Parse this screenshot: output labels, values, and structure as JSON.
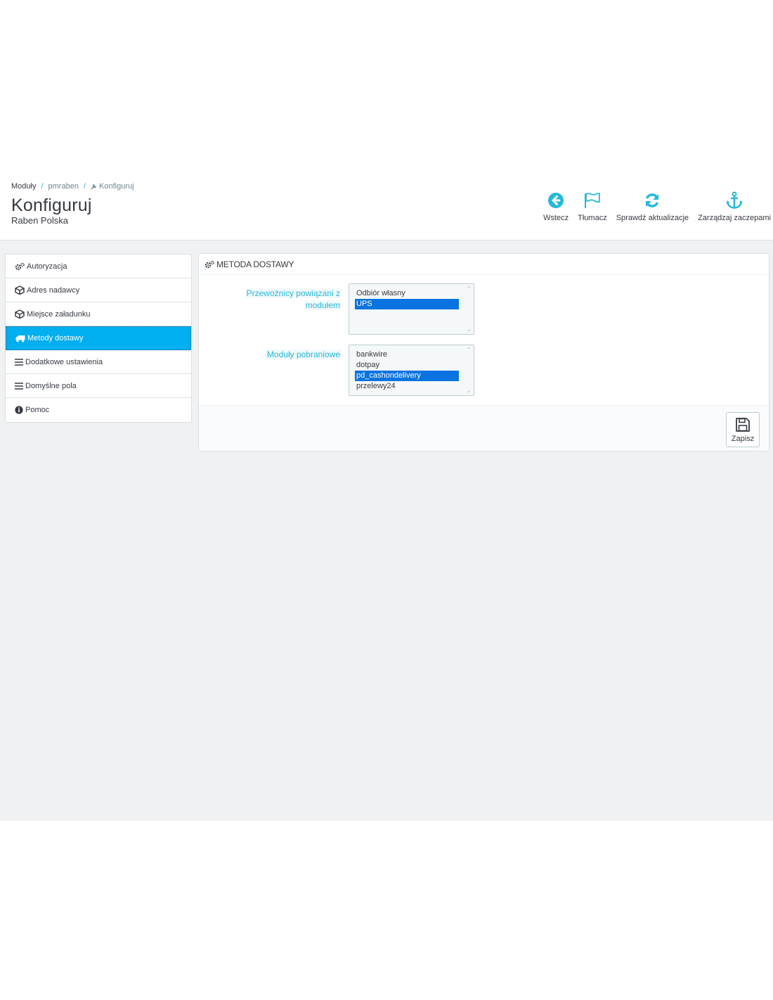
{
  "breadcrumb": {
    "root": "Moduły",
    "parent": "pmraben",
    "current": "Konfiguruj",
    "separator": "/"
  },
  "header": {
    "title": "Konfiguruj",
    "subtitle": "Raben Polska"
  },
  "toolbar": {
    "back": "Wstecz",
    "translate": "Tłumacz",
    "check_updates": "Sprawdź aktualizacje",
    "manage_hooks": "Zarządzaj zaczepami"
  },
  "sidebar": {
    "items": [
      {
        "label": "Autoryzacja",
        "icon": "cogs-icon",
        "active": false
      },
      {
        "label": "Adres nadawcy",
        "icon": "cube-icon",
        "active": false
      },
      {
        "label": "Miejsce załadunku",
        "icon": "cube-icon",
        "active": false
      },
      {
        "label": "Metody dostawy",
        "icon": "truck-icon",
        "active": true
      },
      {
        "label": "Dodatkowe ustawienia",
        "icon": "list-icon",
        "active": false
      },
      {
        "label": "Domyślne pola",
        "icon": "list-icon",
        "active": false
      },
      {
        "label": "Pomoc",
        "icon": "info-icon",
        "active": false
      }
    ]
  },
  "panel": {
    "heading": "METODA DOSTAWY",
    "carriers": {
      "label_line1": "Przewoźnicy powiązani z",
      "label_line2": "modułem",
      "options": [
        "Odbiór własny",
        "UPS"
      ],
      "selected": [
        "UPS"
      ]
    },
    "cod_modules": {
      "label": "Moduły pobraniowe",
      "options": [
        "bankwire",
        "dotpay",
        "pd_cashondelivery",
        "przelewy24"
      ],
      "selected": [
        "pd_cashondelivery"
      ]
    },
    "save_label": "Zapisz"
  },
  "colors": {
    "accent": "#25b9d7",
    "active_menu": "#00aff0",
    "selection": "#0a73e0",
    "background": "#eff1f2"
  }
}
